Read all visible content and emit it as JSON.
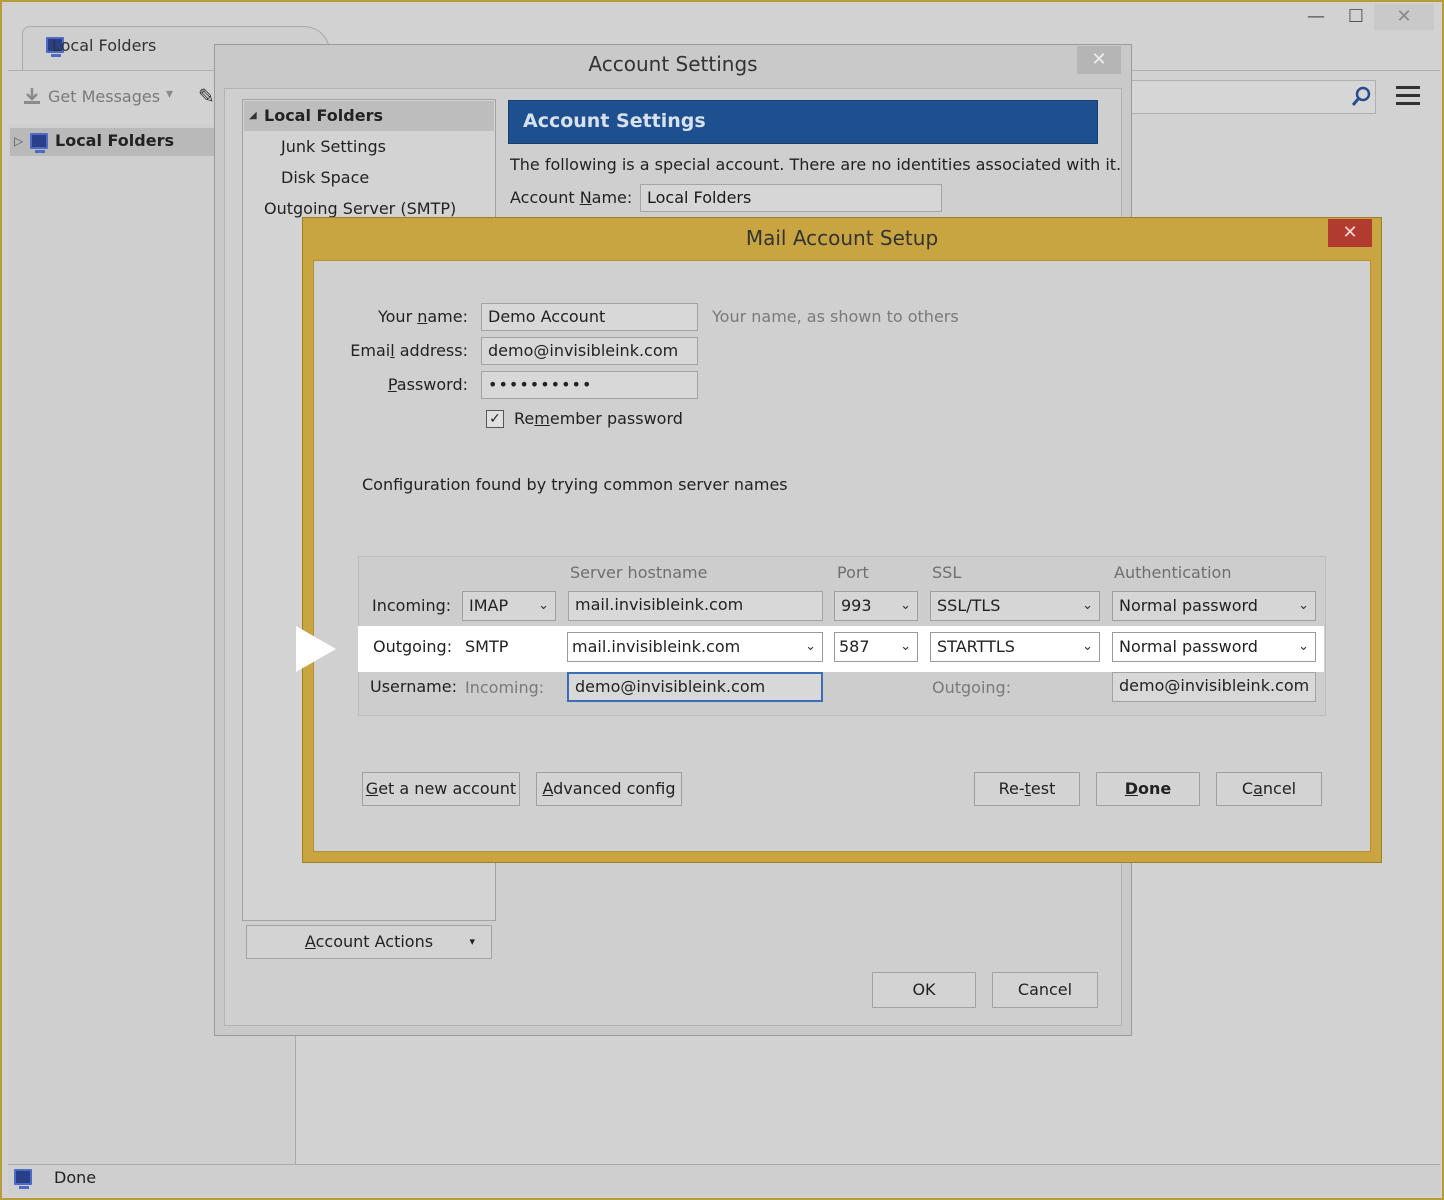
{
  "window": {
    "tab_label": "Local Folders",
    "minimize": "—",
    "maximize": "☐",
    "close": "✕"
  },
  "toolbar": {
    "get_messages": "Get Messages",
    "dropdown_caret": "▾",
    "pencil": "✎"
  },
  "folders": {
    "expand": "▷",
    "root_label": "Local Folders"
  },
  "status": {
    "text": "Done"
  },
  "account_settings": {
    "title": "Account Settings",
    "close": "✕",
    "tree": {
      "header": "Local Folders",
      "header_toggle": "◢",
      "items": [
        "Junk Settings",
        "Disk Space",
        "Outgoing Server (SMTP)"
      ]
    },
    "account_actions": {
      "label_pre": "",
      "label_ul": "A",
      "label_post": "ccount Actions",
      "caret": "▾"
    },
    "banner": "Account Settings",
    "special_text": "The following is a special account. There are no identities associated with it.",
    "account_name_label": {
      "pre": "Account ",
      "ul": "N",
      "post": "ame:"
    },
    "account_name_value": "Local Folders",
    "ok": "OK",
    "cancel": "Cancel"
  },
  "mail_setup": {
    "title": "Mail Account Setup",
    "close": "✕",
    "your_name_label": {
      "pre": "Your ",
      "ul": "n",
      "post": "ame:"
    },
    "your_name_value": "Demo Account",
    "your_name_hint": "Your name, as shown to others",
    "email_label": {
      "pre": "Emai",
      "ul": "l",
      "post": " address:"
    },
    "email_value": "demo@invisibleink.com",
    "password_label": {
      "pre": "",
      "ul": "P",
      "post": "assword:"
    },
    "password_value": "••••••••••",
    "remember_label": {
      "pre": "Re",
      "ul": "m",
      "post": "ember password"
    },
    "remember_checked": "✓",
    "config_found": "Configuration found by trying common server names",
    "columns": {
      "hostname": "Server hostname",
      "port": "Port",
      "ssl": "SSL",
      "auth": "Authentication"
    },
    "incoming": {
      "label": "Incoming:",
      "protocol": "IMAP",
      "hostname": "mail.invisibleink.com",
      "port": "993",
      "ssl": "SSL/TLS",
      "auth": "Normal password"
    },
    "outgoing": {
      "label": "Outgoing:",
      "protocol": "SMTP",
      "hostname": "mail.invisibleink.com",
      "port": "587",
      "ssl": "STARTTLS",
      "auth": "Normal password"
    },
    "username": {
      "label": "Username:",
      "incoming_label": "Incoming:",
      "incoming_value": "demo@invisibleink.com",
      "outgoing_label": "Outgoing:",
      "outgoing_value": "demo@invisibleink.com"
    },
    "chevron": "⌄",
    "buttons": {
      "new_account": {
        "pre": "",
        "ul": "G",
        "post": "et a new account"
      },
      "advanced": {
        "pre": "",
        "ul": "A",
        "post": "dvanced config"
      },
      "retest": {
        "pre": "Re-",
        "ul": "t",
        "post": "est"
      },
      "done": {
        "pre": "",
        "ul": "D",
        "post": "one"
      },
      "cancel": {
        "pre": "C",
        "ul": "a",
        "post": "ncel"
      }
    }
  }
}
